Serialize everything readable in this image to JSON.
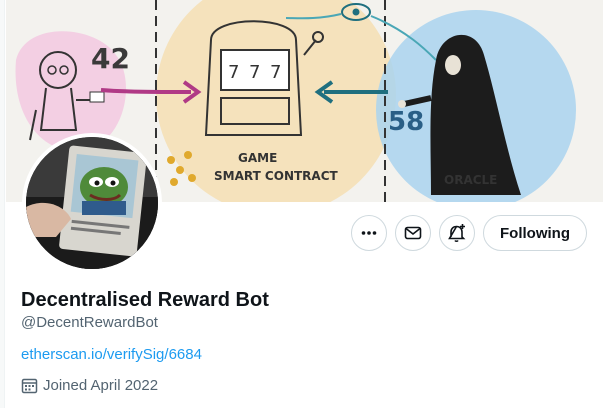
{
  "banner": {
    "number_left": "42",
    "number_right": "58",
    "game_label_line1": "GAME",
    "game_label_line2": "SMART CONTRACT",
    "oracle_label": "ORACLE"
  },
  "profile": {
    "display_name": "Decentralised Reward Bot",
    "handle": "@DecentRewardBot",
    "website": "etherscan.io/verifySig/6684",
    "joined": "Joined April 2022"
  },
  "actions": {
    "more_icon": "more-horizontal-icon",
    "message_icon": "envelope-icon",
    "notify_icon": "bell-plus-icon",
    "follow_label": "Following"
  },
  "colors": {
    "link": "#1d9bf0",
    "secondary_text": "#536471",
    "border": "#cfd9de"
  }
}
